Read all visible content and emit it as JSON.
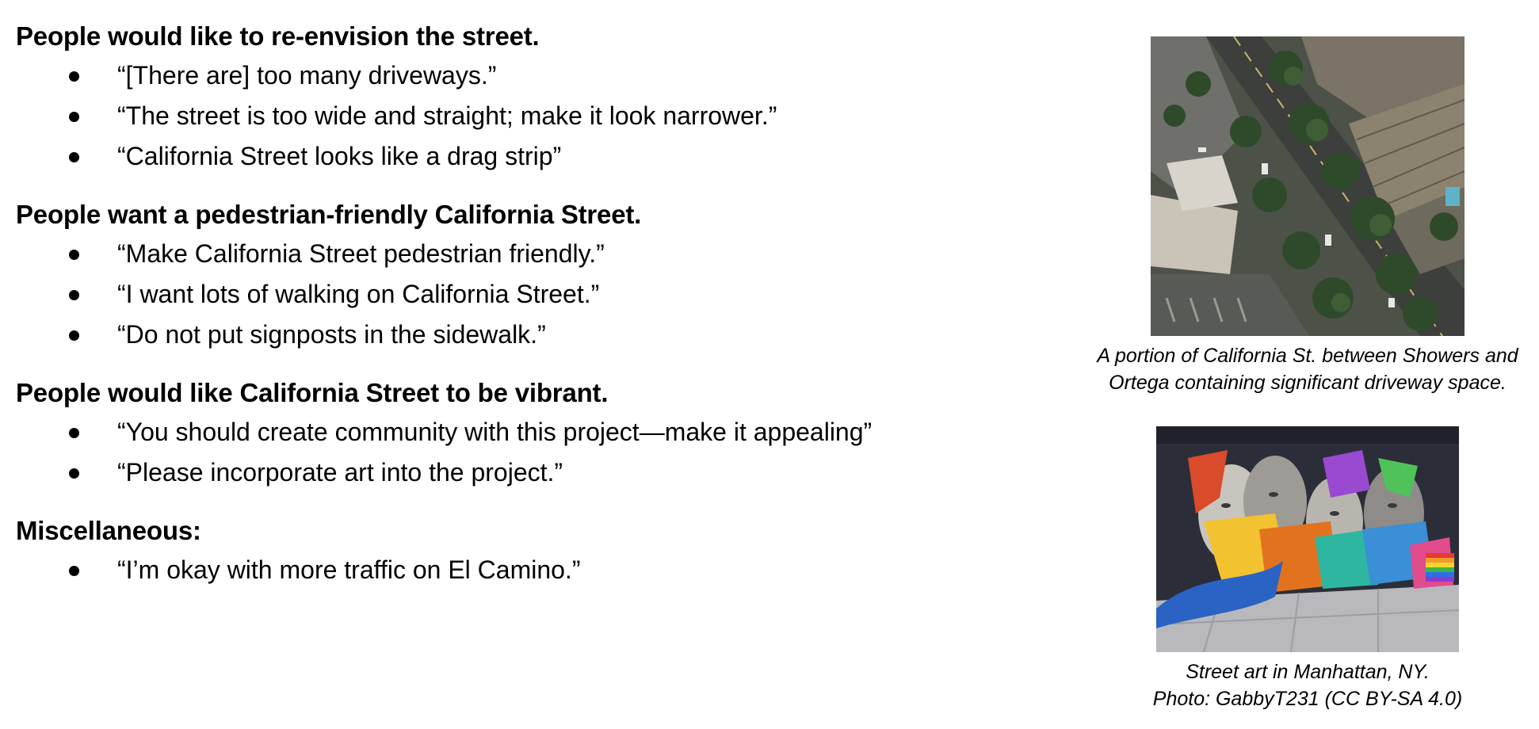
{
  "sections": [
    {
      "heading": "People would like to re-envision the street.",
      "quotes": [
        "“[There are] too many driveways.”",
        "“The street is too wide and straight; make it look narrower.”",
        "“California Street looks like a drag strip”"
      ]
    },
    {
      "heading": "People want a pedestrian-friendly California Street.",
      "quotes": [
        "“Make California Street pedestrian friendly.”",
        "“I want lots of walking on California Street.”",
        "“Do not put signposts in the sidewalk.”"
      ]
    },
    {
      "heading": "People would like California Street to be vibrant.",
      "quotes": [
        "“You should create community with this project—make it appealing”",
        "“Please incorporate art into the project.”"
      ]
    },
    {
      "heading": "Miscellaneous:",
      "quotes": [
        "“I’m okay with more traffic on El Camino.”"
      ]
    }
  ],
  "figures": {
    "aerial": {
      "caption_line1": "A portion of California St. between Showers and",
      "caption_line2": "Ortega containing significant driveway space."
    },
    "mural": {
      "caption_line1": "Street art in Manhattan, NY.",
      "caption_line2": "Photo: GabbyT231 (CC BY-SA 4.0)"
    }
  }
}
